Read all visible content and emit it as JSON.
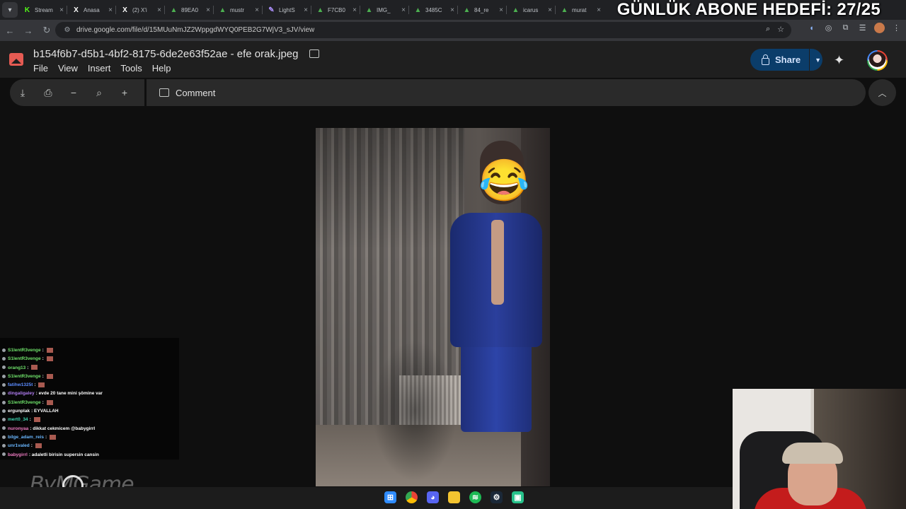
{
  "overlay": {
    "text": "GÜNLÜK ABONE HEDEFİ: 27/25"
  },
  "tabs": [
    {
      "icon": "kick-icon",
      "color": "#53fc18",
      "glyph": "K",
      "title": "Stream"
    },
    {
      "icon": "x-icon",
      "color": "#ffffff",
      "glyph": "X",
      "title": "Anasa"
    },
    {
      "icon": "x-icon",
      "color": "#ffffff",
      "glyph": "X",
      "title": "(2) X'i"
    },
    {
      "icon": "drive-icon",
      "color": "#4caf50",
      "glyph": "▲",
      "title": "89EA0"
    },
    {
      "icon": "drive-icon",
      "color": "#4caf50",
      "glyph": "▲",
      "title": "mustr"
    },
    {
      "icon": "pen-icon",
      "color": "#a88cf5",
      "glyph": "✎",
      "title": "LightS"
    },
    {
      "icon": "drive-icon",
      "color": "#4caf50",
      "glyph": "▲",
      "title": "F7CB0"
    },
    {
      "icon": "drive-icon",
      "color": "#4caf50",
      "glyph": "▲",
      "title": "IMG_"
    },
    {
      "icon": "drive-icon",
      "color": "#4caf50",
      "glyph": "▲",
      "title": "3485C"
    },
    {
      "icon": "drive-icon",
      "color": "#4caf50",
      "glyph": "▲",
      "title": "84_re"
    },
    {
      "icon": "drive-icon",
      "color": "#4caf50",
      "glyph": "▲",
      "title": "icarus"
    },
    {
      "icon": "drive-icon",
      "color": "#4caf50",
      "glyph": "▲",
      "title": "murat"
    }
  ],
  "address": {
    "url": "drive.google.com/file/d/15MUuNmJZ2WppgdWYQ0PEB2G7WjV3_sJV/view"
  },
  "file": {
    "title": "b154f6b7-d5b1-4bf2-8175-6de2e63f52ae - efe orak.jpeg"
  },
  "menu": [
    "File",
    "View",
    "Insert",
    "Tools",
    "Help"
  ],
  "share": {
    "label": "Share",
    "color": "#0b3d6a"
  },
  "toolbar": {
    "comment_label": "Comment"
  },
  "chat": [
    {
      "user": "S1lentR3venge",
      "color": "#6fe26a",
      "msg": ""
    },
    {
      "user": "S1lentR3venge",
      "color": "#6fe26a",
      "msg": ""
    },
    {
      "user": "orang13",
      "color": "#6fe26a",
      "msg": ""
    },
    {
      "user": "S1lentR3venge",
      "color": "#6fe26a",
      "msg": ""
    },
    {
      "user": "fatihw1325t",
      "color": "#5b8cff",
      "msg": ""
    },
    {
      "user": "dingaligaley",
      "color": "#b07cf0",
      "msg": "evde 20 tane mini şömine var"
    },
    {
      "user": "S1lentR3venge",
      "color": "#6fe26a",
      "msg": ""
    },
    {
      "user": "ergunplak",
      "color": "#ffffff",
      "msg": "EYVALLAH"
    },
    {
      "user": "mert0_34",
      "color": "#3ed6b1",
      "msg": ""
    },
    {
      "user": "nuronyaa",
      "color": "#f07cc3",
      "msg": "dikkat cekmicem @babygirrl"
    },
    {
      "user": "bilge_adam_reis",
      "color": "#6ab7ff",
      "msg": ""
    },
    {
      "user": "unr1valed",
      "color": "#6ab7ff",
      "msg": ""
    },
    {
      "user": "babygirrl",
      "color": "#f07cc3",
      "msg": "adaletli birisin supersin cansin"
    }
  ],
  "watermark": {
    "text": "ByMGame"
  }
}
